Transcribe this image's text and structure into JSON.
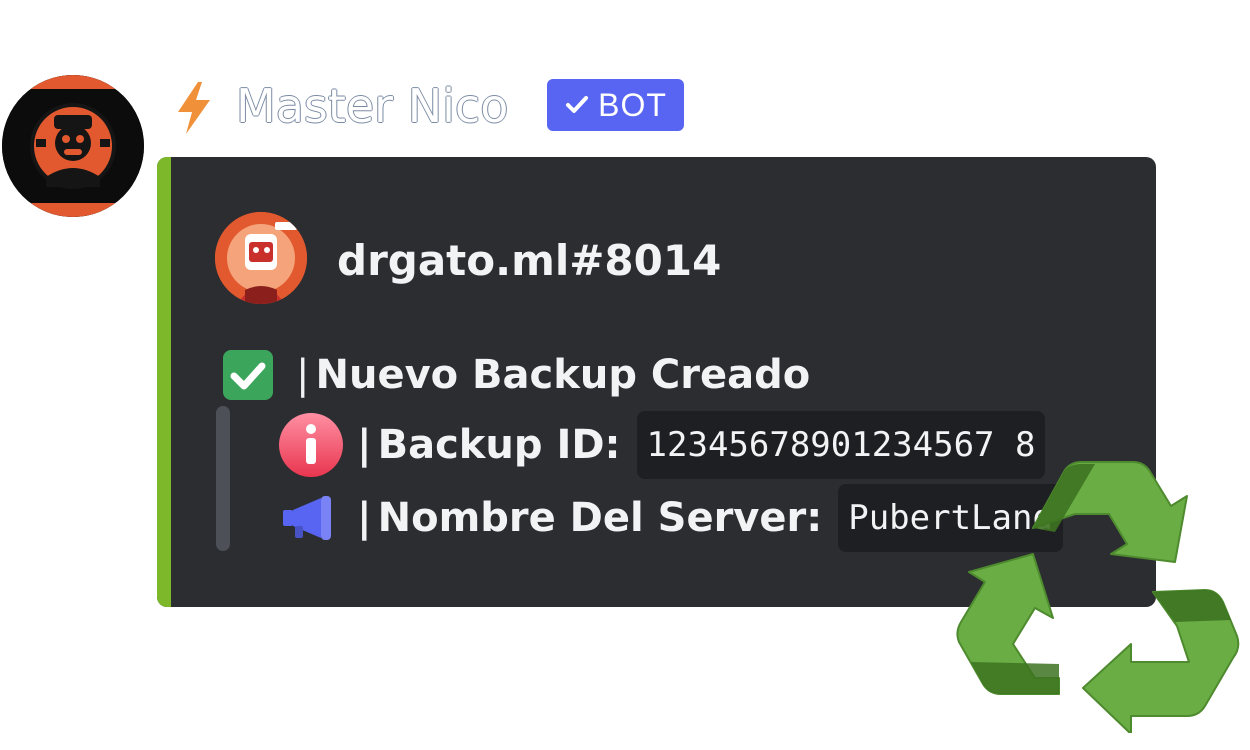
{
  "message": {
    "username": "Master Nico",
    "badge_label": "BOT",
    "avatar_icon": "robot-avatar-icon",
    "name_icon": "lightning-icon"
  },
  "embed": {
    "accent_color": "#7cb829",
    "author": {
      "name": "drgato.ml#8014",
      "avatar_icon": "author-avatar-icon"
    },
    "title": {
      "icon": "check-mark-button-icon",
      "separator": "|",
      "text": "Nuevo Backup Creado"
    },
    "fields": [
      {
        "icon": "info-icon",
        "separator": "|",
        "label": "Backup ID:",
        "value": "12345678901234567 8"
      },
      {
        "icon": "megaphone-icon",
        "separator": "|",
        "label": "Nombre Del Server:",
        "value": "PubertLand"
      }
    ]
  },
  "overlay": {
    "icon": "recycle-icon",
    "color": "#6aad45"
  }
}
